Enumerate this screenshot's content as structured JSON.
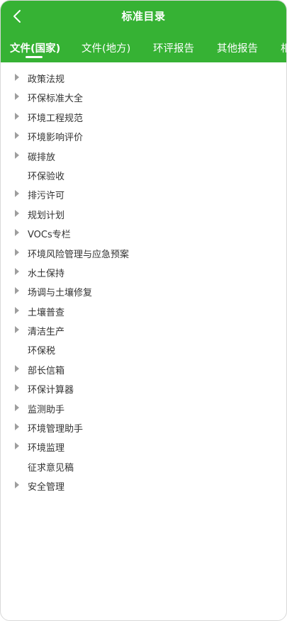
{
  "header": {
    "title": "标准目录",
    "back_icon": "chevron-left-icon",
    "background": "#36b234"
  },
  "tabs": [
    {
      "label": "文件(国家)",
      "active": true
    },
    {
      "label": "文件(地方)",
      "active": false
    },
    {
      "label": "环评报告",
      "active": false
    },
    {
      "label": "其他报告",
      "active": false
    },
    {
      "label": "相",
      "active": false
    }
  ],
  "items": [
    {
      "label": "政策法规",
      "expandable": true
    },
    {
      "label": "环保标准大全",
      "expandable": true
    },
    {
      "label": "环境工程规范",
      "expandable": true
    },
    {
      "label": "环境影响评价",
      "expandable": true
    },
    {
      "label": "碳排放",
      "expandable": true
    },
    {
      "label": "环保验收",
      "expandable": false
    },
    {
      "label": "排污许可",
      "expandable": true
    },
    {
      "label": "规划计划",
      "expandable": true
    },
    {
      "label": "VOCs专栏",
      "expandable": true
    },
    {
      "label": "环境风险管理与应急预案",
      "expandable": true
    },
    {
      "label": "水土保持",
      "expandable": true
    },
    {
      "label": "场调与土壤修复",
      "expandable": true
    },
    {
      "label": "土壤普查",
      "expandable": true
    },
    {
      "label": "清洁生产",
      "expandable": true
    },
    {
      "label": "环保税",
      "expandable": false
    },
    {
      "label": "部长信箱",
      "expandable": true
    },
    {
      "label": "环保计算器",
      "expandable": true
    },
    {
      "label": "监测助手",
      "expandable": true
    },
    {
      "label": "环境管理助手",
      "expandable": true
    },
    {
      "label": "环境监理",
      "expandable": true
    },
    {
      "label": "征求意见稿",
      "expandable": false
    },
    {
      "label": "安全管理",
      "expandable": true
    }
  ]
}
